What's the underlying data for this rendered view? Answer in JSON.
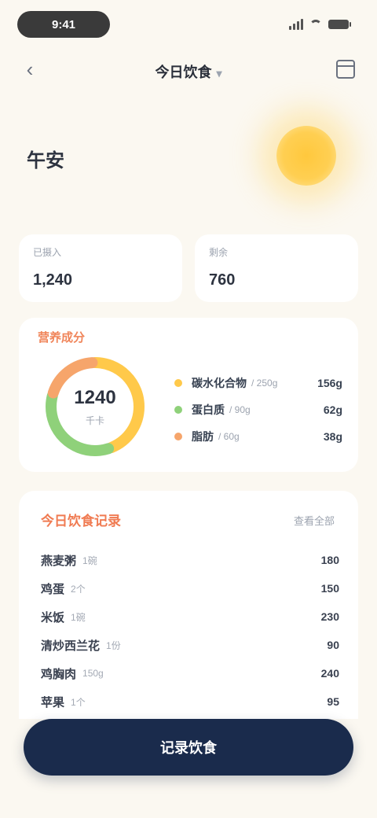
{
  "status_bar": {
    "time": "9:41"
  },
  "header": {
    "title": "今日饮食",
    "chevron": "▾",
    "back_glyph": "‹"
  },
  "greeting": {
    "text": "午安"
  },
  "stats": [
    {
      "label": "已摄入",
      "value": "1,240"
    },
    {
      "label": "剩余",
      "value": "760"
    }
  ],
  "macros": {
    "title": "营养成分",
    "ring_value": "1240",
    "ring_unit": "千卡",
    "ring_fraction": 0.62,
    "items": [
      {
        "name": "碳水化合物",
        "target": "/ 250g",
        "amount": "156g",
        "color": "#ffc94a",
        "fraction": 0.45
      },
      {
        "name": "蛋白质",
        "target": "/ 90g",
        "amount": "62g",
        "color": "#8fd17a",
        "fraction": 0.35
      },
      {
        "name": "脂肪",
        "target": "/ 60g",
        "amount": "38g",
        "color": "#f6a56b",
        "fraction": 0.2
      }
    ]
  },
  "foods": {
    "title": "今日饮食记录",
    "view_all": "查看全部",
    "items": [
      {
        "name": "燕麦粥",
        "portion": "1碗",
        "kcal": "180"
      },
      {
        "name": "鸡蛋",
        "portion": "2个",
        "kcal": "150"
      },
      {
        "name": "米饭",
        "portion": "1碗",
        "kcal": "230"
      },
      {
        "name": "清炒西兰花",
        "portion": "1份",
        "kcal": "90"
      },
      {
        "name": "鸡胸肉",
        "portion": "150g",
        "kcal": "240"
      },
      {
        "name": "苹果",
        "portion": "1个",
        "kcal": "95"
      }
    ]
  },
  "cta": {
    "label": "记录饮食"
  },
  "colors": {
    "accent": "#f07b52",
    "cta": "#1a2b4c",
    "sun": "#ffc83d"
  }
}
